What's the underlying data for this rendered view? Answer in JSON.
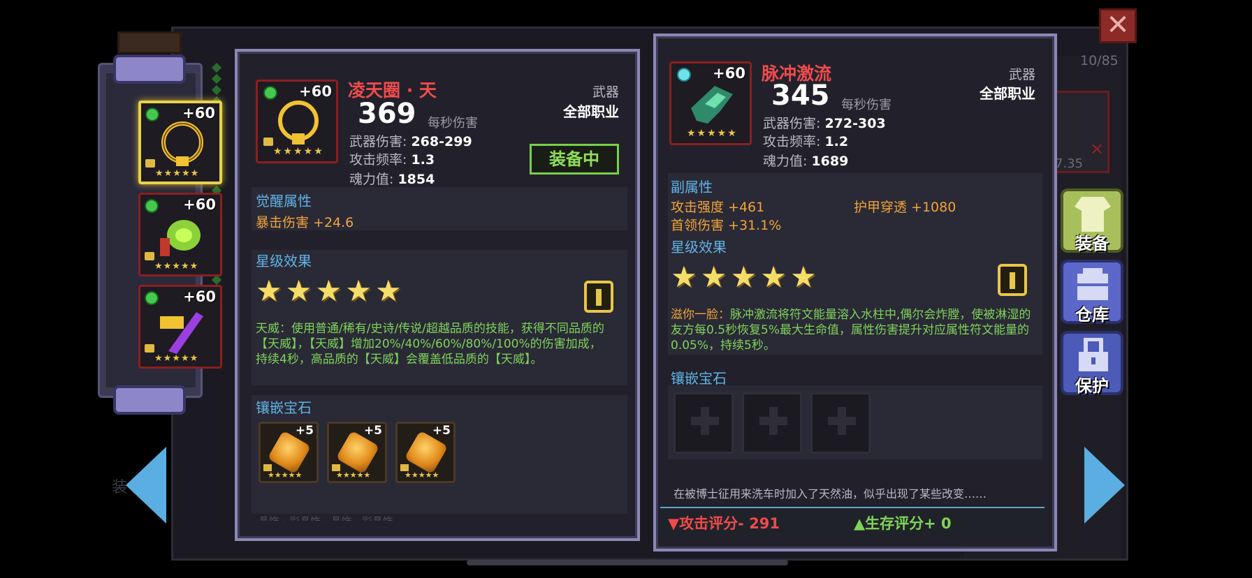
{
  "count": "10/85",
  "ghost_card_value": "7.35",
  "ghost_text": "装    案",
  "left_item": {
    "name": "凌天圈 · 天",
    "level": "+60",
    "dps": "369",
    "dps_label": "每秒伤害",
    "type": "武器",
    "class": "全部职业",
    "stats": [
      {
        "label": "武器伤害:",
        "value": "268-299"
      },
      {
        "label": "攻击频率:",
        "value": "1.3"
      },
      {
        "label": "魂力值:",
        "value": "1854"
      }
    ],
    "equipped_label": "装备中",
    "awaken_title": "觉醒属性",
    "awaken_stat": "暴击伤害 +24.6",
    "star_title": "星级效果",
    "star_desc": "天威：使用普通/稀有/史诗/传说/超越品质的技能，获得不同品质的【天威】，【天威】增加20%/40%/60%/80%/100%的伤害加成，持续4秒，高品质的【天威】会覆盖低品质的【天威】。",
    "gem_title": "镶嵌宝石",
    "gems": [
      "+5",
      "+5",
      "+5"
    ],
    "bottom_cut": "晶饰 · 彩晶饰 · 晶饰 · 彩晶饰"
  },
  "right_item": {
    "name": "脉冲激流",
    "level": "+60",
    "dps": "345",
    "dps_label": "每秒伤害",
    "type": "武器",
    "class": "全部职业",
    "stats": [
      {
        "label": "武器伤害:",
        "value": "272-303"
      },
      {
        "label": "攻击频率:",
        "value": "1.2"
      },
      {
        "label": "魂力值:",
        "value": "1689"
      }
    ],
    "sub_title": "副属性",
    "sub_stats": [
      "攻击强度 +461",
      "护甲穿透 +1080",
      "首领伤害 +31.1%"
    ],
    "star_title": "星级效果",
    "star_desc_prefix": "滋你一脸：",
    "star_desc": "脉冲激流将符文能量溶入水柱中,偶尔会炸膛，使被淋湿的友方每0.5秒恢复5%最大生命值，属性伤害提升对应属性符文能量的0.05%，持续5秒。",
    "gem_title": "镶嵌宝石",
    "flavor": "在被博士征用来洗车时加入了天然油，似乎出现了某些改变……",
    "attack_score": "▼攻击评分- 291",
    "survive_score": "▲生存评分+ 0"
  },
  "slots": [
    {
      "level": "+60",
      "stars": "★★★★★"
    },
    {
      "level": "+60",
      "stars": "★★★★★"
    },
    {
      "level": "+60",
      "stars": "★★★★★"
    }
  ],
  "side_buttons": {
    "equip": "装备",
    "storage": "仓库",
    "protect": "保护"
  },
  "colors": {
    "accent_red": "#ef4b4b",
    "accent_green": "#7ed45a",
    "accent_blue": "#5fb4e6",
    "accent_orange": "#f0a43a"
  }
}
